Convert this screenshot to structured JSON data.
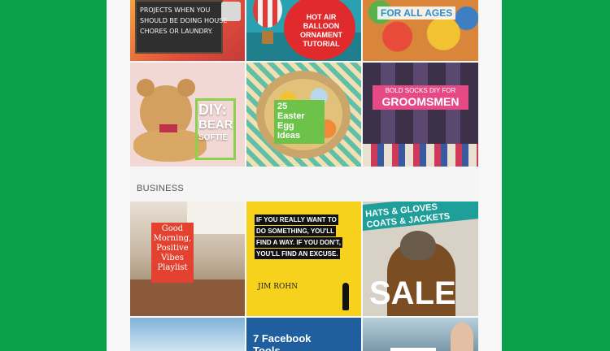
{
  "colors": {
    "frame": "#0aa04a",
    "panel": "#f8f8f8"
  },
  "grid": {
    "row1": [
      {
        "lines": [
          "PROJECTS WHEN YOU",
          "SHOULD BE DOING HOUSE",
          "CHORES OR LAUNDRY."
        ]
      },
      {
        "lines": [
          "HOT AIR",
          "BALLOON",
          "ORNAMENT",
          "TUTORIAL"
        ]
      },
      {
        "text": "FOR ALL AGES"
      }
    ],
    "row2": [
      {
        "lines": [
          "DIY:",
          "BEAR",
          "SOFTIE"
        ]
      },
      {
        "lines": [
          "25",
          "Easter",
          "Egg",
          "Ideas"
        ]
      },
      {
        "lines": [
          "BOLD SOCKS DIY FOR",
          "GROOMSMEN"
        ]
      }
    ]
  },
  "section": {
    "label": "BUSINESS"
  },
  "business": [
    {
      "lines": [
        "Good",
        "Morning,",
        "Positive",
        "Vibes",
        "Playlist"
      ]
    },
    {
      "lines": [
        "IF YOU REALLY WANT TO",
        "DO SOMETHING, YOU'LL",
        "FIND A WAY. IF YOU DON'T,",
        "YOU'LL FIND AN EXCUSE."
      ],
      "author": "JIM ROHN"
    },
    {
      "lines": [
        "HATS & GLOVES",
        "COATS & JACKETS"
      ],
      "sale": "SALE"
    }
  ],
  "row4": [
    {
      "text": ""
    },
    {
      "lines": [
        "7 Facebook",
        "Tools"
      ]
    },
    {
      "text": ""
    }
  ]
}
